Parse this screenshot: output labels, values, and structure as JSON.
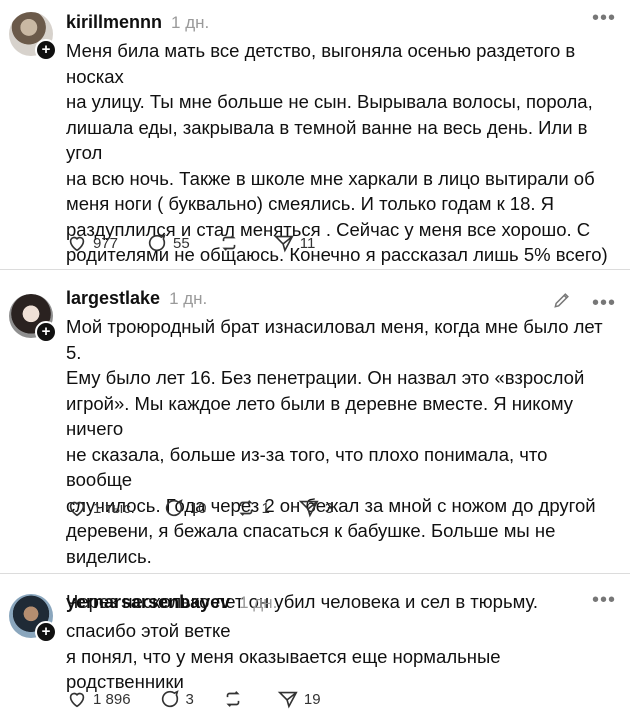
{
  "posts": [
    {
      "username": "kirillmennn",
      "time": "1 дн.",
      "text": "Меня била мать все детство, выгоняла осенью раздетого в носках\nна улицу. Ты мне больше не сын. Вырывала волосы, порола,\nлишала еды, закрывала в темной ванне на весь день. Или в угол\nна всю ночь. Также в школе мне харкали в лицо вытирали об\nменя ноги ( буквально) смеялись. И только годам к 18. Я\nраздуплился и стал меняться . Сейчас у меня все хорошо. С\nродителями не общаюсь. Конечно я рассказал лишь 5% всего)",
      "likes": "977",
      "replies": "55",
      "reposts": "",
      "shares": "11"
    },
    {
      "username": "largestlake",
      "time": "1 дн.",
      "text": "Мой троюродный брат изнасиловал меня, когда мне было лет 5.\nЕму было лет 16. Без пенетрации. Он назвал это «взрослой\nигрой». Мы каждое лето были в деревне вместе. Я никому ничего\nне сказала, больше из-за того, что плохо понимала, что вообще\nслучилось. Года через 2 он бежал за мной с ножом до другой\nдеревени, я бежала спасаться к бабушке. Больше мы не виделись.",
      "text2": "Через несколько лет он убил человека и сел в тюрьму.",
      "likes": "1 тыс.",
      "replies": "10",
      "reposts": "1",
      "shares": "3"
    },
    {
      "username": "yernarsarsenbayev",
      "time": "1 дн.",
      "text": "спасибо этой ветке\nя понял, что у меня оказывается еще нормальные родственники",
      "likes": "1 896",
      "replies": "3",
      "reposts": "",
      "shares": "19"
    }
  ],
  "icons": {
    "more": "more-icon",
    "edit": "pencil-icon",
    "like": "heart-icon",
    "reply": "comment-icon",
    "repost": "repost-icon",
    "share": "send-icon",
    "plus": "plus-icon"
  },
  "colors": {
    "text": "#101010",
    "muted": "#9a9a9a",
    "divider": "#dcdcdc"
  }
}
